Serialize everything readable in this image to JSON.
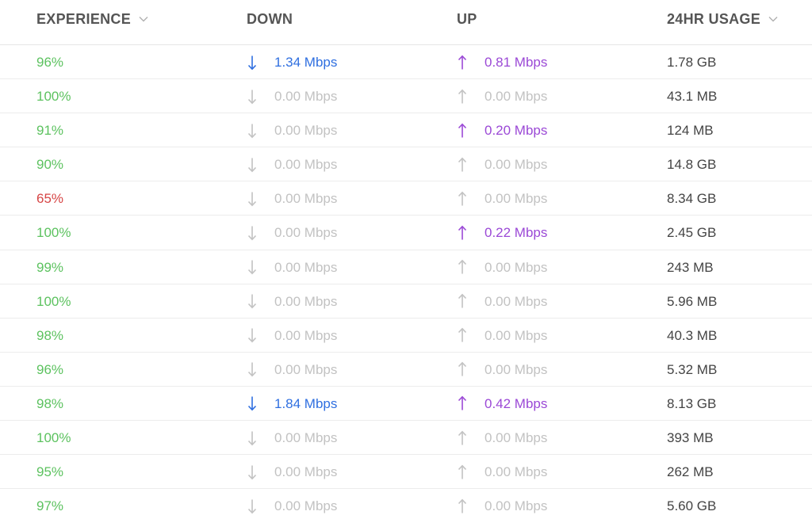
{
  "colors": {
    "good": "#5cc25f",
    "bad": "#d64545",
    "down_active": "#2f6fe0",
    "up_active": "#9b49d6",
    "inactive": "#c2c2c2",
    "text": "#444444",
    "header_text": "#555555"
  },
  "headers": {
    "experience": "EXPERIENCE",
    "down": "DOWN",
    "up": "UP",
    "usage": "24HR USAGE"
  },
  "rows": [
    {
      "experience": "96%",
      "experience_status": "good",
      "down": "1.34 Mbps",
      "down_active": true,
      "up": "0.81 Mbps",
      "up_active": true,
      "usage": "1.78 GB"
    },
    {
      "experience": "100%",
      "experience_status": "good",
      "down": "0.00 Mbps",
      "down_active": false,
      "up": "0.00 Mbps",
      "up_active": false,
      "usage": "43.1 MB"
    },
    {
      "experience": "91%",
      "experience_status": "good",
      "down": "0.00 Mbps",
      "down_active": false,
      "up": "0.20 Mbps",
      "up_active": true,
      "usage": "124 MB"
    },
    {
      "experience": "90%",
      "experience_status": "good",
      "down": "0.00 Mbps",
      "down_active": false,
      "up": "0.00 Mbps",
      "up_active": false,
      "usage": "14.8 GB"
    },
    {
      "experience": "65%",
      "experience_status": "bad",
      "down": "0.00 Mbps",
      "down_active": false,
      "up": "0.00 Mbps",
      "up_active": false,
      "usage": "8.34 GB"
    },
    {
      "experience": "100%",
      "experience_status": "good",
      "down": "0.00 Mbps",
      "down_active": false,
      "up": "0.22 Mbps",
      "up_active": true,
      "usage": "2.45 GB"
    },
    {
      "experience": "99%",
      "experience_status": "good",
      "down": "0.00 Mbps",
      "down_active": false,
      "up": "0.00 Mbps",
      "up_active": false,
      "usage": "243 MB"
    },
    {
      "experience": "100%",
      "experience_status": "good",
      "down": "0.00 Mbps",
      "down_active": false,
      "up": "0.00 Mbps",
      "up_active": false,
      "usage": "5.96 MB"
    },
    {
      "experience": "98%",
      "experience_status": "good",
      "down": "0.00 Mbps",
      "down_active": false,
      "up": "0.00 Mbps",
      "up_active": false,
      "usage": "40.3 MB"
    },
    {
      "experience": "96%",
      "experience_status": "good",
      "down": "0.00 Mbps",
      "down_active": false,
      "up": "0.00 Mbps",
      "up_active": false,
      "usage": "5.32 MB"
    },
    {
      "experience": "98%",
      "experience_status": "good",
      "down": "1.84 Mbps",
      "down_active": true,
      "up": "0.42 Mbps",
      "up_active": true,
      "usage": "8.13 GB"
    },
    {
      "experience": "100%",
      "experience_status": "good",
      "down": "0.00 Mbps",
      "down_active": false,
      "up": "0.00 Mbps",
      "up_active": false,
      "usage": "393 MB"
    },
    {
      "experience": "95%",
      "experience_status": "good",
      "down": "0.00 Mbps",
      "down_active": false,
      "up": "0.00 Mbps",
      "up_active": false,
      "usage": "262 MB"
    },
    {
      "experience": "97%",
      "experience_status": "good",
      "down": "0.00 Mbps",
      "down_active": false,
      "up": "0.00 Mbps",
      "up_active": false,
      "usage": "5.60 GB"
    }
  ]
}
